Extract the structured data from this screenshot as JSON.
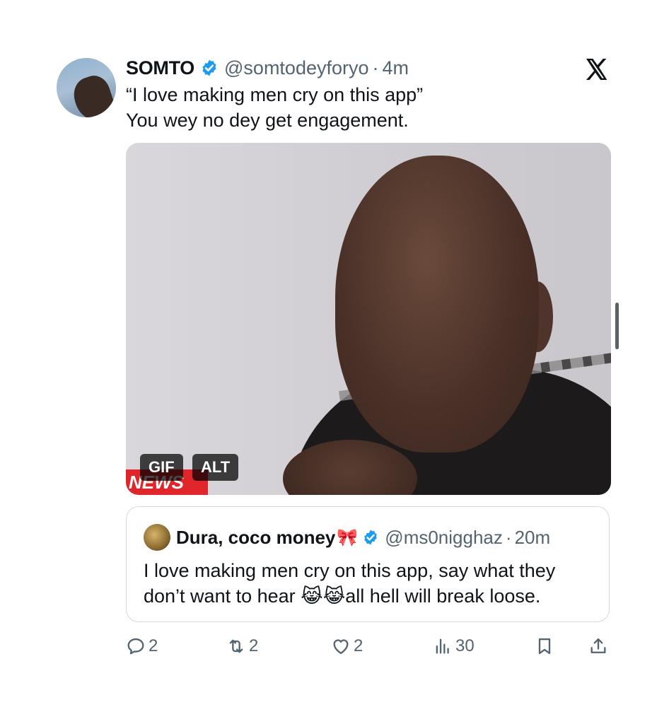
{
  "tweet": {
    "author_name": "SOMTO",
    "handle": "@somtodeyforyo",
    "separator": "·",
    "time": "4m",
    "text_lines": [
      "“I love making men cry on this app”",
      "You wey no dey get engagement."
    ],
    "media": {
      "gif_badge": "GIF",
      "alt_badge": "ALT",
      "overlay_text": "NEWS"
    }
  },
  "quoted": {
    "author_name": "Dura, coco money",
    "name_emoji": "🎀",
    "handle": "@ms0nigghaz",
    "separator": "·",
    "time": "20m",
    "text_lines": [
      "I love making men cry on this app, say what they",
      "don’t want to hear 😹😹all hell will break loose."
    ]
  },
  "actions": {
    "replies": "2",
    "reposts": "2",
    "likes": "2",
    "views": "30"
  },
  "icons": {
    "brand": "x-logo-icon",
    "verified": "verified-badge-icon",
    "reply": "reply-icon",
    "repost": "repost-icon",
    "like": "heart-icon",
    "views": "views-chart-icon",
    "bookmark": "bookmark-icon",
    "share": "share-icon"
  },
  "colors": {
    "verified": "#1d9bf0",
    "secondary_text": "#536471",
    "news_banner": "#e0262b"
  }
}
